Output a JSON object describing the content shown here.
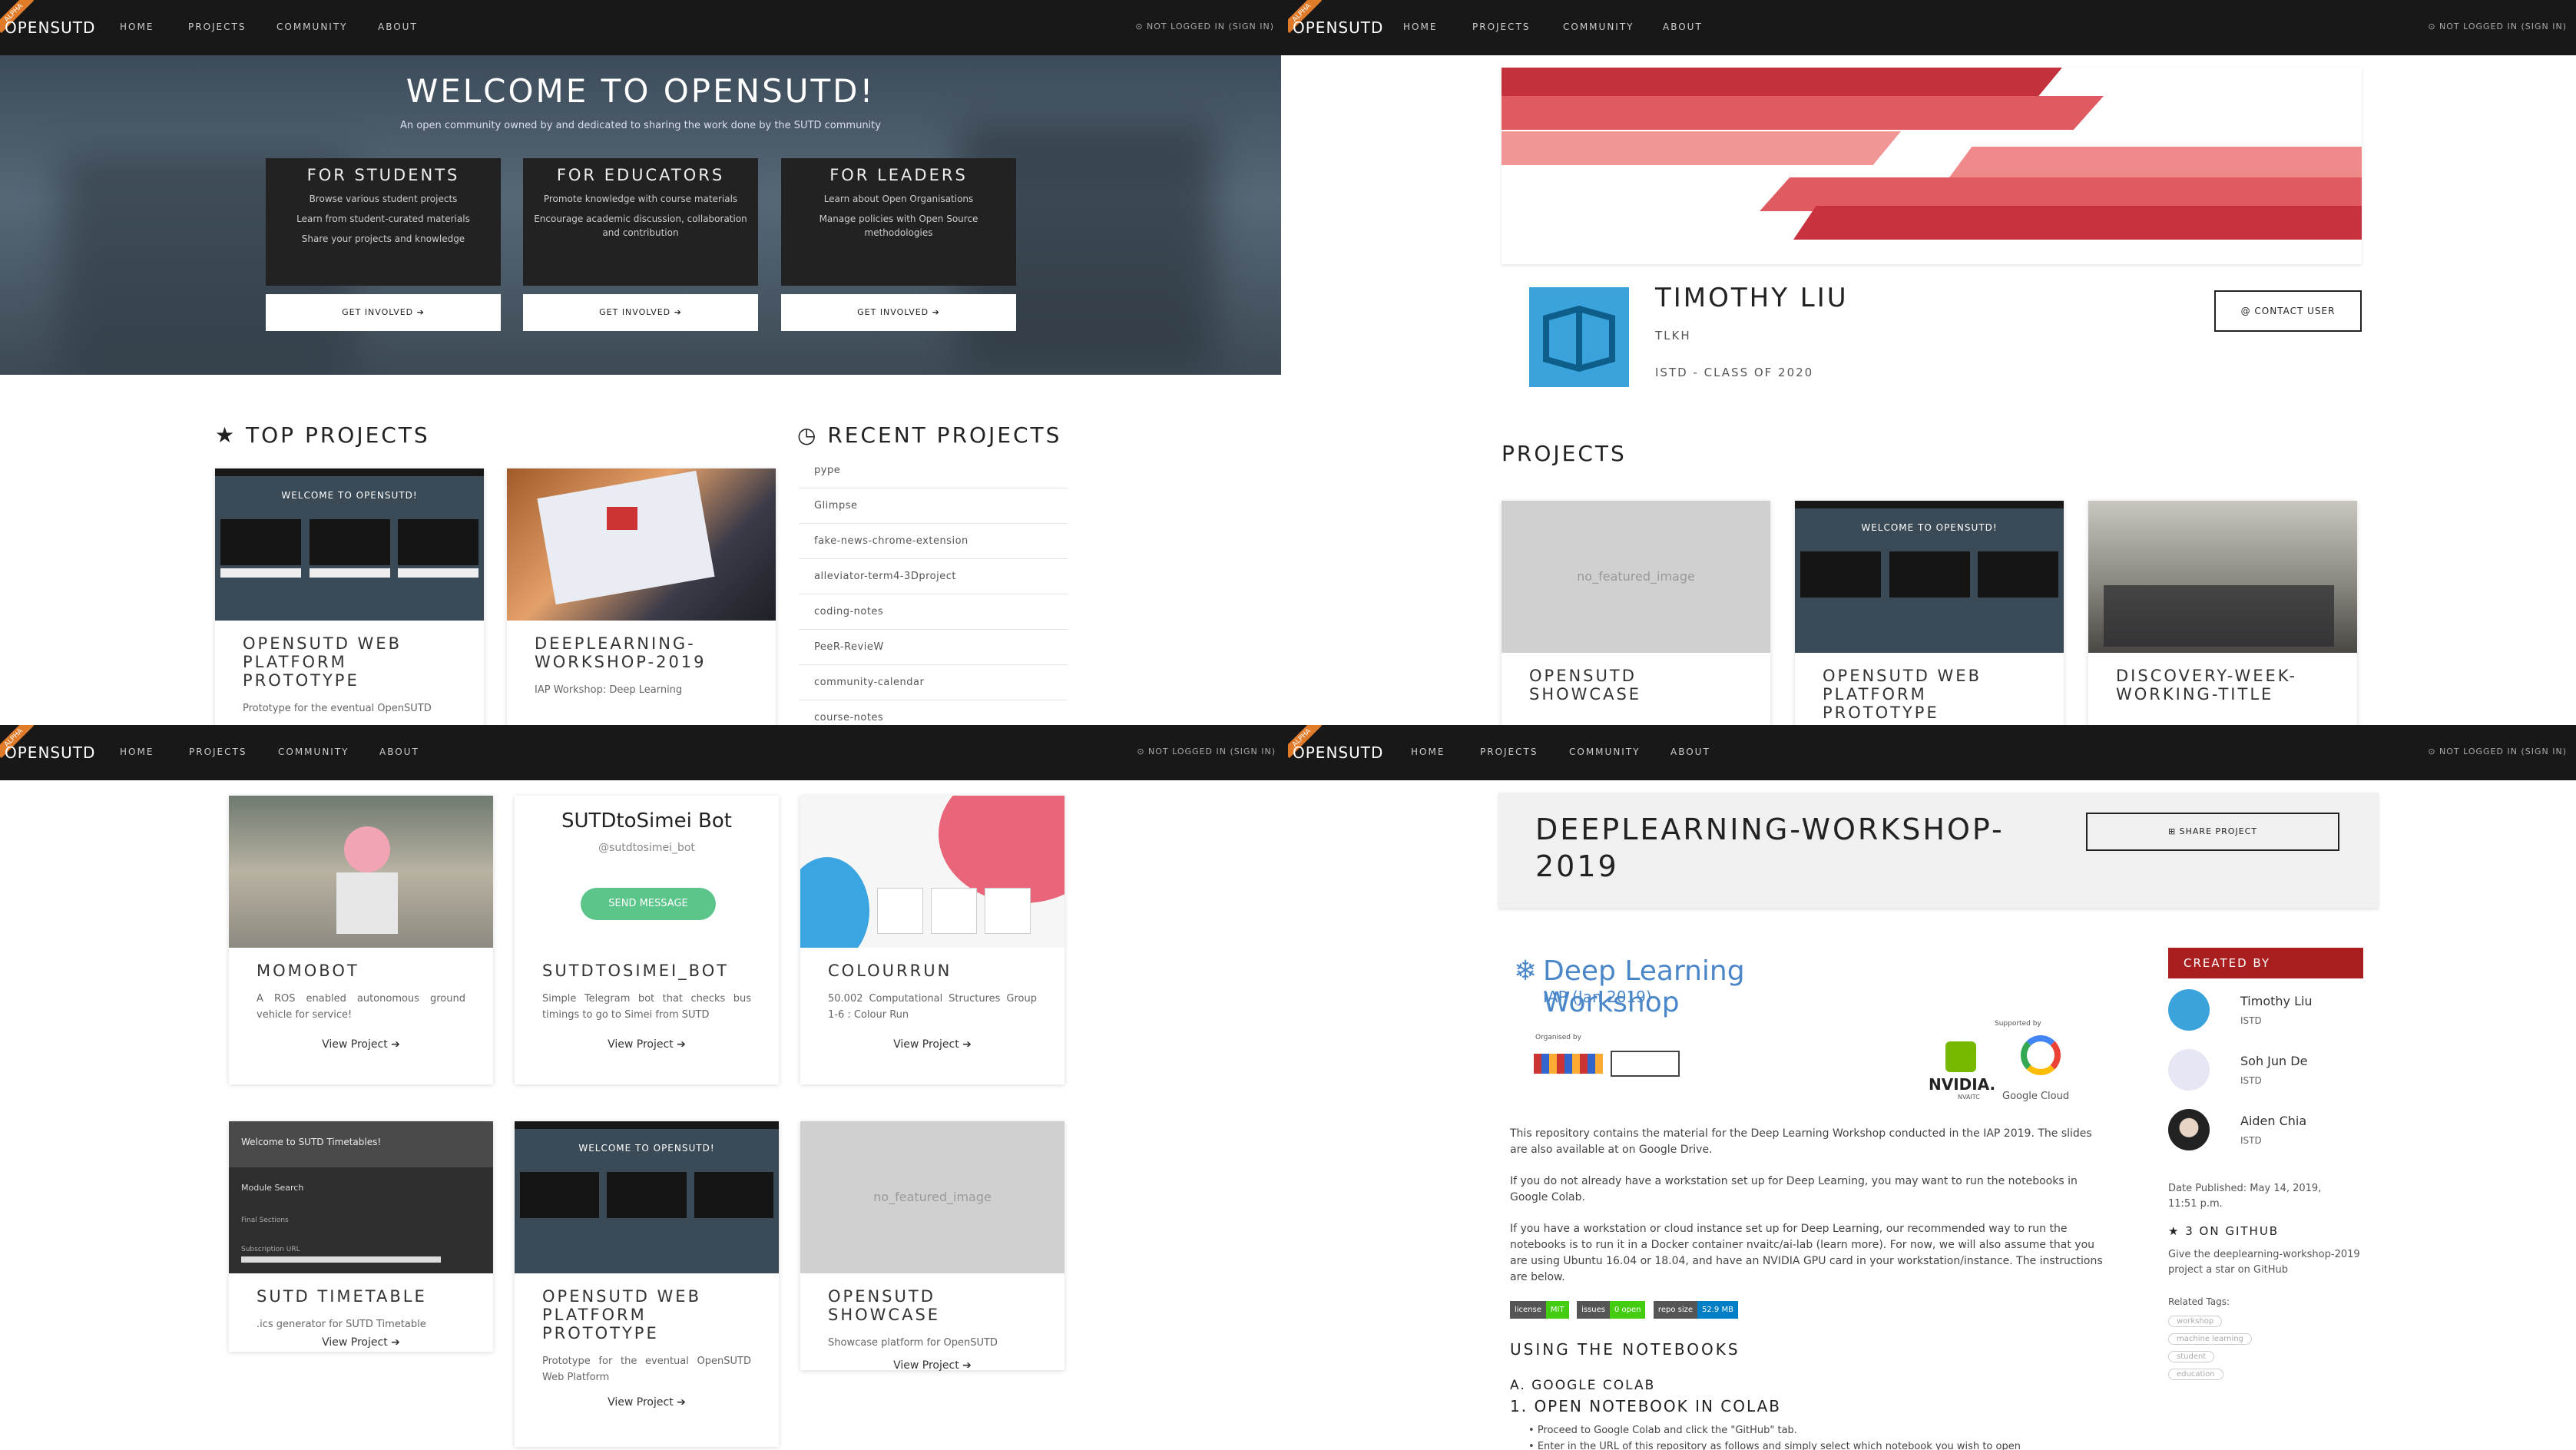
{
  "nav": {
    "brand": "OPENSUTD",
    "ribbon": "ALPHA",
    "links": [
      "HOME",
      "PROJECTS",
      "COMMUNITY",
      "ABOUT"
    ],
    "login": "NOT LOGGED IN (SIGN IN)"
  },
  "home": {
    "title": "WELCOME TO OPENSUTD!",
    "subtitle": "An open community owned by and dedicated to sharing the work done by the SUTD community",
    "cards": [
      {
        "title": "FOR STUDENTS",
        "lines": [
          "Browse various student projects",
          "Learn from student-curated materials",
          "Share your projects and knowledge"
        ],
        "button": "GET INVOLVED ➔"
      },
      {
        "title": "FOR EDUCATORS",
        "lines": [
          "Promote knowledge with course materials",
          "Encourage academic discussion, collaboration and contribution"
        ],
        "button": "GET INVOLVED ➔"
      },
      {
        "title": "FOR LEADERS",
        "lines": [
          "Learn about Open Organisations",
          "Manage policies with Open Source methodologies"
        ],
        "button": "GET INVOLVED ➔"
      }
    ],
    "top_projects_heading": "TOP PROJECTS",
    "recent_projects_heading": "RECENT PROJECTS",
    "top_projects": [
      {
        "title": "OPENSUTD WEB PLATFORM PROTOTYPE",
        "desc": "Prototype for the eventual OpenSUTD",
        "thumb_text": "WELCOME TO OPENSUTD!"
      },
      {
        "title": "DEEPLEARNING-WORKSHOP-2019",
        "desc": "IAP Workshop: Deep Learning"
      }
    ],
    "recent_projects": [
      "pype",
      "Glimpse",
      "fake-news-chrome-extension",
      "alleviator-term4-3Dproject",
      "coding-notes",
      "PeeR-RevieW",
      "community-calendar",
      "course-notes"
    ]
  },
  "profile": {
    "name": "TIMOTHY LIU",
    "handle": "TLKH",
    "affiliation": "ISTD - CLASS OF 2020",
    "contact_button": "CONTACT USER",
    "projects_heading": "PROJECTS",
    "projects": [
      {
        "title": "OPENSUTD SHOWCASE",
        "placeholder": "no_featured_image"
      },
      {
        "title": "OPENSUTD WEB PLATFORM PROTOTYPE",
        "thumb_text": "WELCOME TO OPENSUTD!"
      },
      {
        "title": "DISCOVERY-WEEK-WORKING-TITLE"
      }
    ]
  },
  "listing": {
    "view": "View Project ➔",
    "row1": [
      {
        "title": "MOMOBOT",
        "desc": "A ROS enabled autonomous ground vehicle for service!"
      },
      {
        "title": "SUTDTOSIMEI_BOT",
        "desc": "Simple Telegram bot that checks bus timings to go to Simei from SUTD",
        "bot_name": "SUTDtoSimei Bot",
        "bot_handle": "@sutdtosimei_bot",
        "bot_button": "SEND MESSAGE"
      },
      {
        "title": "COLOURRUN",
        "desc": "50.002 Computational Structures Group 1-6 : Colour Run"
      }
    ],
    "row2": [
      {
        "title": "SUTD TIMETABLE",
        "desc": ".ics generator for SUTD Timetable",
        "thumb_title": "Welcome to SUTD Timetables!",
        "thumb_label1": "Module Search",
        "thumb_label2": "Final Sections",
        "thumb_label3": "Subscription URL"
      },
      {
        "title": "OPENSUTD WEB PLATFORM PROTOTYPE",
        "desc": "Prototype for the eventual OpenSUTD Web Platform",
        "thumb_text": "WELCOME TO OPENSUTD!"
      },
      {
        "title": "OPENSUTD SHOWCASE",
        "desc": "Showcase platform for OpenSUTD",
        "placeholder": "no_featured_image"
      }
    ]
  },
  "project": {
    "title": "DEEPLEARNING-WORKSHOP-2019",
    "share_button": "SHARE PROJECT",
    "dl_title": "Deep Learning Workshop",
    "dl_sub": "IAP (Jan 2019)",
    "organised_by": "Organised by",
    "supported_by": "Supported by",
    "nvidia": "NVIDIA.",
    "nvaitc": "NVAITC",
    "gcloud": "Google Cloud",
    "para1": "This repository contains the material for the Deep Learning Workshop conducted in the IAP 2019. The slides are also available at on Google Drive.",
    "para2": "If you do not already have a workstation set up for Deep Learning, you may want to run the notebooks in Google Colab.",
    "para3": "If you have a workstation or cloud instance set up for Deep Learning, our recommended way to run the notebooks is to run it in a Docker container nvaitc/ai-lab (learn more). For now, we will also assume that you are using Ubuntu 16.04 or 18.04, and have an NVIDIA GPU card in your workstation/instance. The instructions are below.",
    "badges": [
      {
        "k": "license",
        "v": "MIT"
      },
      {
        "k": "issues",
        "v": "0 open"
      },
      {
        "k": "repo size",
        "v": "52.9 MB"
      }
    ],
    "h_using": "USING THE NOTEBOOKS",
    "h_a": "A. GOOGLE COLAB",
    "h_1": "1. OPEN NOTEBOOK IN COLAB",
    "bullet1": "Proceed to Google Colab and click the \"GitHub\" tab.",
    "bullet2": "Enter in the URL of this repository as follows and simply select which notebook you wish to open",
    "created_by": "CREATED BY",
    "creators": [
      {
        "name": "Timothy Liu",
        "school": "ISTD"
      },
      {
        "name": "Soh Jun De",
        "school": "ISTD"
      },
      {
        "name": "Aiden Chia",
        "school": "ISTD"
      }
    ],
    "date": "Date Published: May 14, 2019, 11:51 p.m.",
    "stars": "3 ON GITHUB",
    "star_note": "Give the deeplearning-workshop-2019 project a star on GitHub",
    "related_tags": "Related Tags:",
    "tags": [
      "workshop",
      "machine learning",
      "student",
      "education"
    ]
  },
  "colors": {
    "nav": "#181818",
    "accent_red": "#a91e1e",
    "ribbon": "#e07b2a",
    "send": "#5cc58a"
  }
}
